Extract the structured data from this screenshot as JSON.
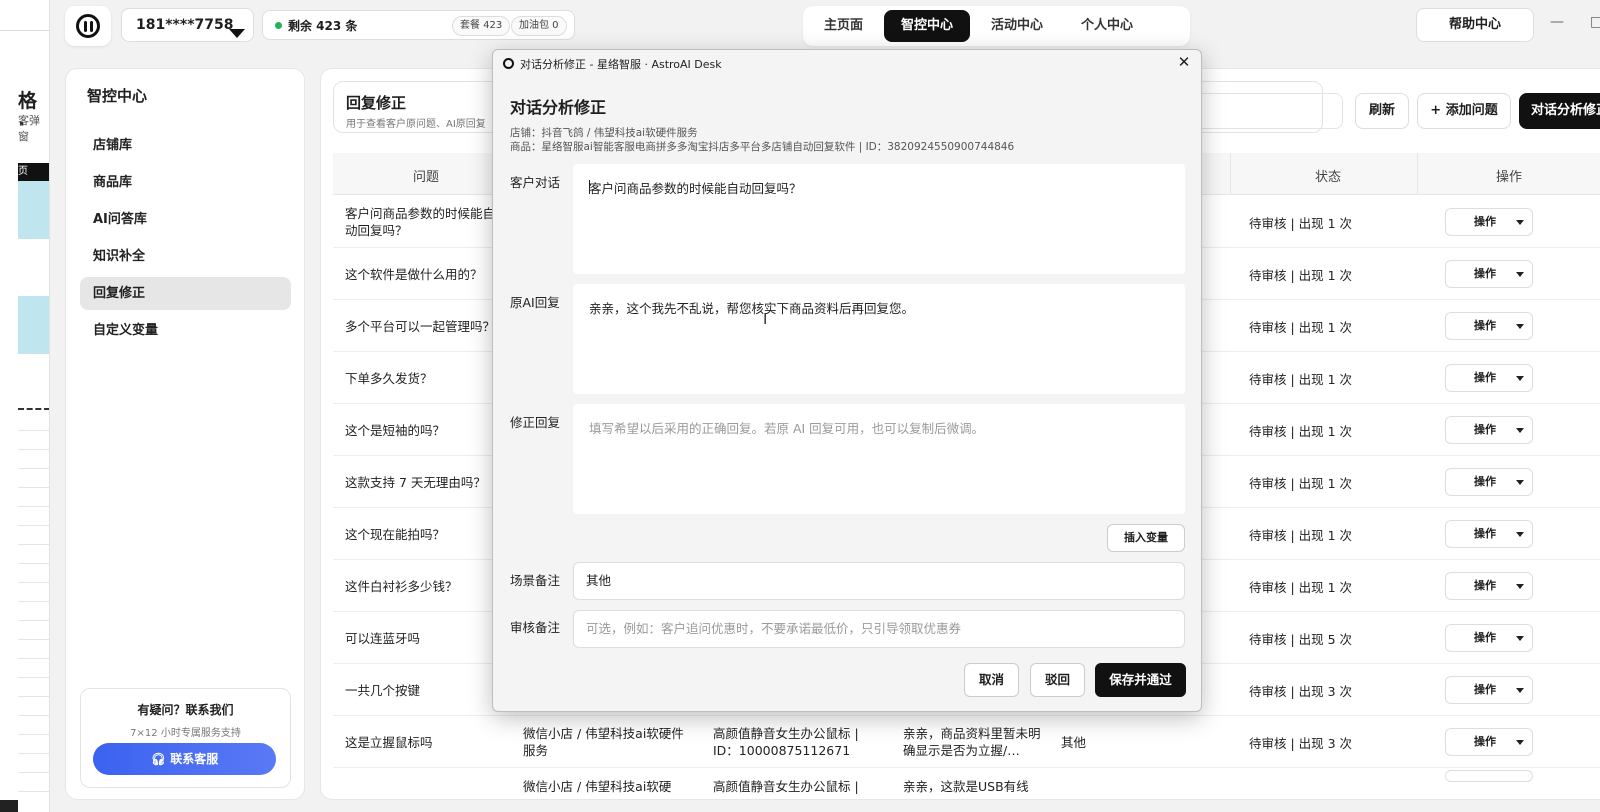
{
  "bg_left": {
    "title": "格 ·",
    "subtitle": "客弹窗",
    "header_cell": "页"
  },
  "topbar": {
    "account": "181****7758",
    "quota_main": "剩余 423 条",
    "quota_chip1": "套餐 423",
    "quota_chip2": "加油包 0",
    "nav": [
      {
        "label": "主页面"
      },
      {
        "label": "智控中心"
      },
      {
        "label": "活动中心"
      },
      {
        "label": "个人中心"
      }
    ],
    "help": "帮助中心",
    "minimize": "—",
    "maximize": "□"
  },
  "sidebar": {
    "title": "智控中心",
    "items": [
      {
        "label": "店铺库"
      },
      {
        "label": "商品库"
      },
      {
        "label": "AI问答库"
      },
      {
        "label": "知识补全"
      },
      {
        "label": "回复修正"
      },
      {
        "label": "自定义变量"
      }
    ],
    "support_title": "有疑问？联系我们",
    "support_sub": "7×12 小时专属服务支持",
    "support_btn": "联系客服"
  },
  "main": {
    "section_title": "回复修正",
    "section_desc": "用于查看客户原问题、AI原回复",
    "refresh": "刷新",
    "add": "+ 添加问题",
    "analyze": "对话分析修正",
    "headers": {
      "question": "问题",
      "status": "状态",
      "action": "操作"
    },
    "rows": [
      {
        "question": "客户问商品参数的时候能自动回复吗？",
        "status": "待审核 | 出现 1 次",
        "op": "操作"
      },
      {
        "question": "这个软件是做什么用的？",
        "status": "待审核 | 出现 1 次",
        "op": "操作"
      },
      {
        "question": "多个平台可以一起管理吗？",
        "status": "待审核 | 出现 1 次",
        "op": "操作"
      },
      {
        "question": "下单多久发货？",
        "status": "待审核 | 出现 1 次",
        "op": "操作"
      },
      {
        "question": "这个是短袖的吗？",
        "status": "待审核 | 出现 1 次",
        "op": "操作"
      },
      {
        "question": "这款支持 7 天无理由吗？",
        "status": "待审核 | 出现 1 次",
        "op": "操作"
      },
      {
        "question": "这个现在能拍吗？",
        "status": "待审核 | 出现 1 次",
        "op": "操作"
      },
      {
        "question": "这件白衬衫多少钱？",
        "status": "待审核 | 出现 1 次",
        "op": "操作"
      },
      {
        "question": "可以连蓝牙吗",
        "status": "待审核 | 出现 5 次",
        "op": "操作"
      },
      {
        "question": "一共几个按键",
        "status": "待审核 | 出现 3 次",
        "op": "操作"
      },
      {
        "question": "这是立握鼠标吗",
        "shop": "微信小店 / 伟望科技ai软硬件服务",
        "product": "高颜值静音女生办公鼠标 | ID：10000875112671",
        "reply": "亲亲，商品资料里暂未明确显示是否为立握/…",
        "scene": "其他",
        "status": "待审核 | 出现 3 次",
        "op": "操作"
      },
      {
        "question": "",
        "shop": "微信小店 / 伟望科技ai软硬",
        "product": "高颜值静音女生办公鼠标 |",
        "reply": "亲亲，这款是USB有线",
        "status": "",
        "op": ""
      }
    ]
  },
  "dialog": {
    "window_title": "对话分析修正 - 星络智服 · AstroAI Desk",
    "heading": "对话分析修正",
    "shop_line": "店铺：抖音飞鸽 / 伟望科技ai软硬件服务",
    "product_line": "商品：星络智服ai智能客服电商拼多多淘宝抖店多平台多店铺自动回复软件 | ID：3820924550900744846",
    "customer_label": "客户对话",
    "customer_text": "客户问商品参数的时候能自动回复吗？",
    "original_label": "原AI回复",
    "original_text": "亲亲，这个我先不乱说，帮您核实下商品资料后再回复您。",
    "fix_label": "修正回复",
    "fix_placeholder": "填写希望以后采用的正确回复。若原 AI 回复可用，也可以复制后微调。",
    "insert_var": "插入变量",
    "scene_label": "场景备注",
    "scene_value": "其他",
    "review_label": "审核备注",
    "review_placeholder": "可选，例如：客户追问优惠时，不要承诺最低价，只引导领取优惠券",
    "cancel": "取消",
    "reject": "驳回",
    "save": "保存并通过"
  }
}
